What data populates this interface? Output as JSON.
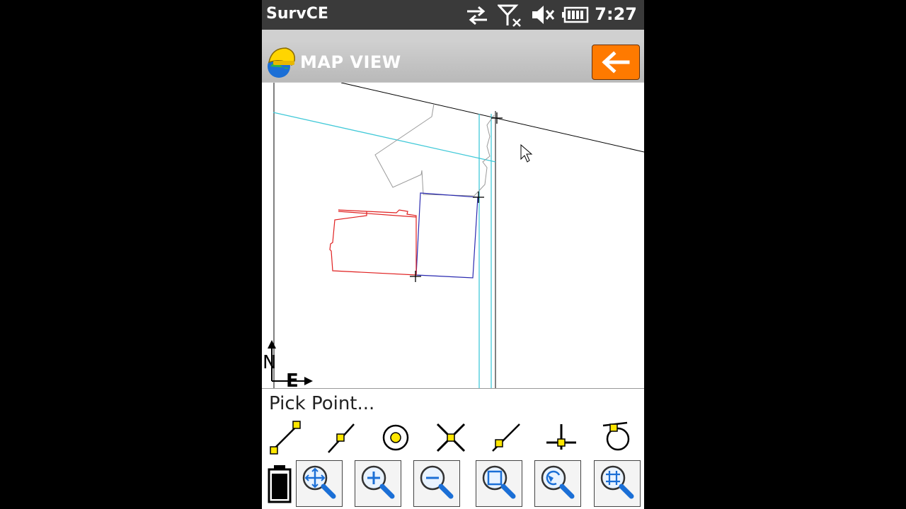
{
  "status_bar": {
    "app_name": "SurvCE",
    "time": "7:27",
    "icons": [
      "sync-arrows-icon",
      "no-signal-icon",
      "mute-icon",
      "battery-icon"
    ]
  },
  "title_bar": {
    "title": "MAP VIEW",
    "back_icon": "arrow-left-icon",
    "back_color": "#ff7a00"
  },
  "map": {
    "north_label": "N",
    "east_label": "E",
    "colors": {
      "boundary": "#000000",
      "road": "#41c9d8",
      "building_red": "#e02020",
      "parcel_blue": "#2a2ab0",
      "outline_gray": "#9a9a9a"
    }
  },
  "prompt": {
    "text": "Pick Point..."
  },
  "snap_tools": [
    "snap-endpoint-icon",
    "snap-midpoint-icon",
    "snap-center-icon",
    "snap-intersection-icon",
    "snap-nearest-icon",
    "snap-perpendicular-icon",
    "snap-tangent-icon"
  ],
  "zoom_tools": [
    "zoom-pan-icon",
    "zoom-in-icon",
    "zoom-out-icon",
    "zoom-window-icon",
    "zoom-previous-icon",
    "zoom-extents-icon"
  ]
}
